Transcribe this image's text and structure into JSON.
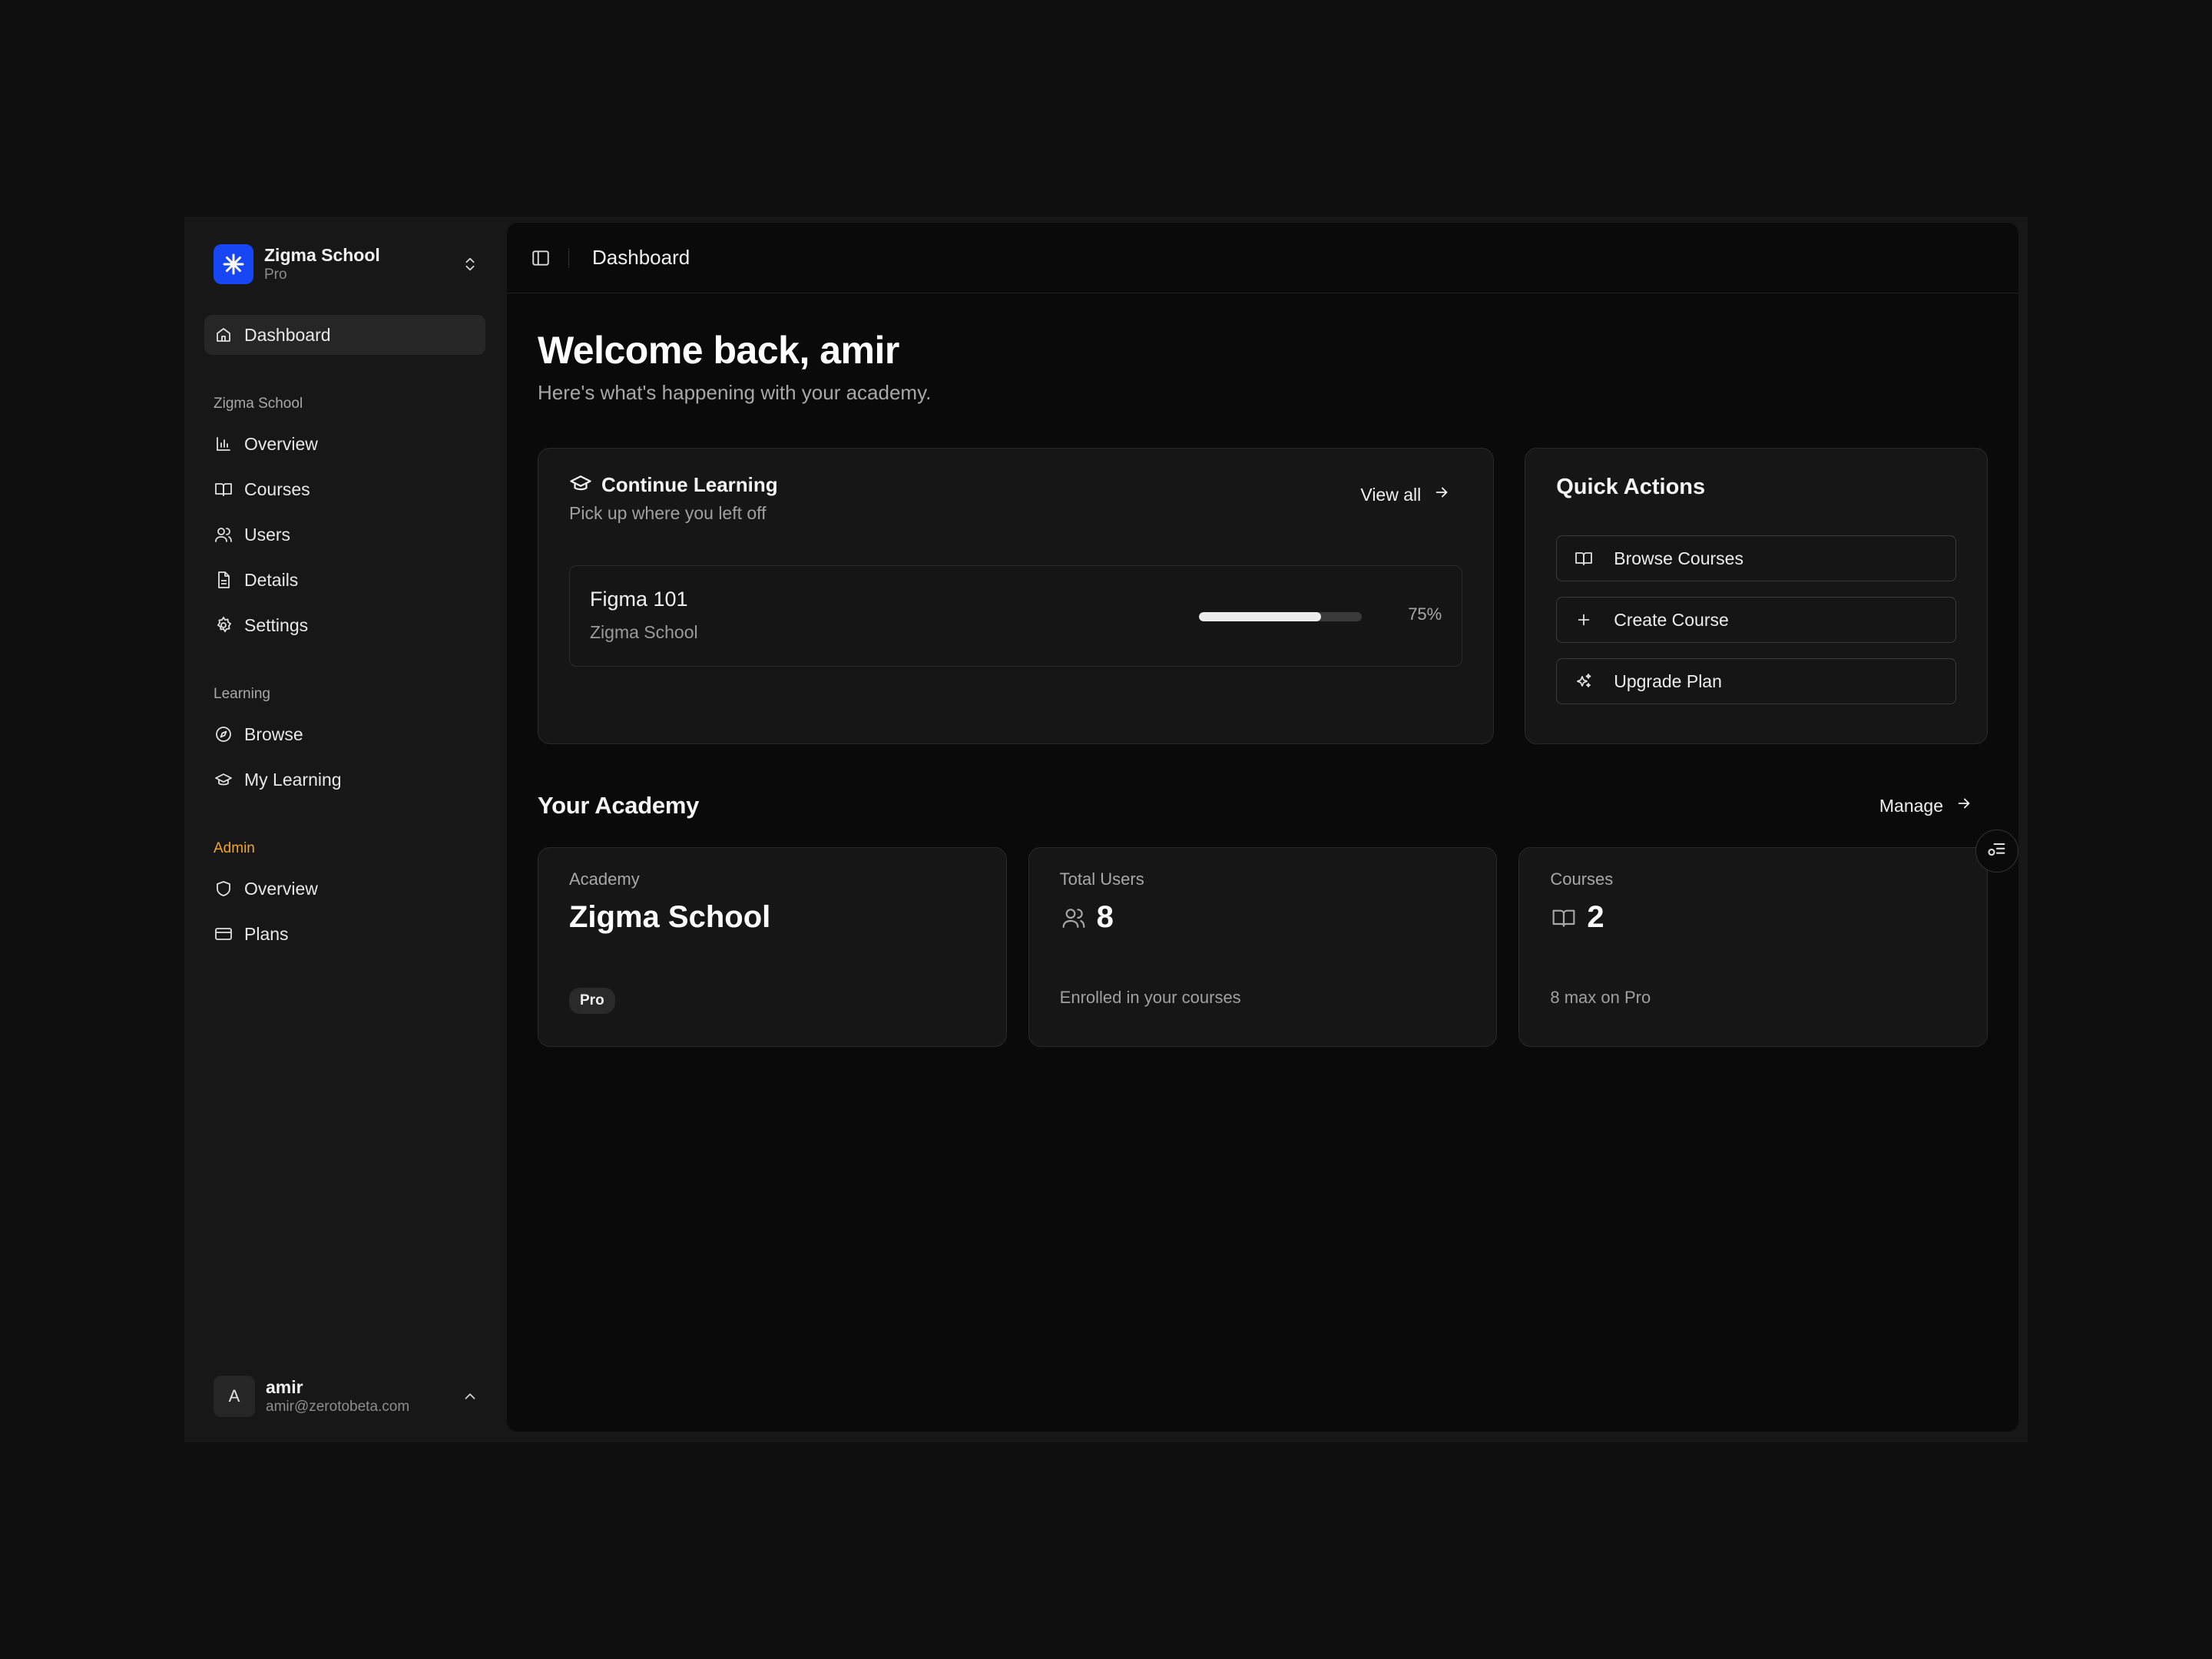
{
  "sidebar": {
    "org": {
      "name": "Zigma School",
      "plan": "Pro",
      "logo_icon": "asterisk-icon",
      "logo_color": "#1747f5"
    },
    "top_item": {
      "label": "Dashboard",
      "icon": "home-icon"
    },
    "groups": [
      {
        "label": "Zigma School",
        "items": [
          {
            "label": "Overview",
            "icon": "bar-chart-icon"
          },
          {
            "label": "Courses",
            "icon": "book-open-icon"
          },
          {
            "label": "Users",
            "icon": "users-icon"
          },
          {
            "label": "Details",
            "icon": "file-text-icon"
          },
          {
            "label": "Settings",
            "icon": "gear-icon"
          }
        ]
      },
      {
        "label": "Learning",
        "items": [
          {
            "label": "Browse",
            "icon": "compass-icon"
          },
          {
            "label": "My Learning",
            "icon": "graduation-cap-icon"
          }
        ]
      },
      {
        "label": "Admin",
        "label_color": "#f5a524",
        "items": [
          {
            "label": "Overview",
            "icon": "shield-icon"
          },
          {
            "label": "Plans",
            "icon": "credit-card-icon"
          }
        ]
      }
    ],
    "user": {
      "initial": "A",
      "name": "amir",
      "email": "amir@zerotobeta.com"
    }
  },
  "topbar": {
    "breadcrumb": "Dashboard"
  },
  "welcome": {
    "title": "Welcome back, amir",
    "subtitle": "Here's what's happening with your academy."
  },
  "continue_learning": {
    "title": "Continue Learning",
    "subtitle": "Pick up where you left off",
    "view_all": "View all",
    "course": {
      "name": "Figma 101",
      "org": "Zigma School",
      "progress": 0.75,
      "progress_label": "75%"
    }
  },
  "quick_actions": {
    "title": "Quick Actions",
    "items": [
      {
        "label": "Browse Courses",
        "icon": "book-open-icon"
      },
      {
        "label": "Create Course",
        "icon": "plus-icon"
      },
      {
        "label": "Upgrade Plan",
        "icon": "sparkles-icon"
      }
    ]
  },
  "academy": {
    "title": "Your Academy",
    "manage": "Manage",
    "stats": [
      {
        "label": "Academy",
        "value": "Zigma School",
        "badge": "Pro"
      },
      {
        "label": "Total Users",
        "value": "8",
        "note": "Enrolled in your courses",
        "icon": "users-icon"
      },
      {
        "label": "Courses",
        "value": "2",
        "note": "8 max on Pro",
        "icon": "book-open-icon"
      }
    ]
  }
}
